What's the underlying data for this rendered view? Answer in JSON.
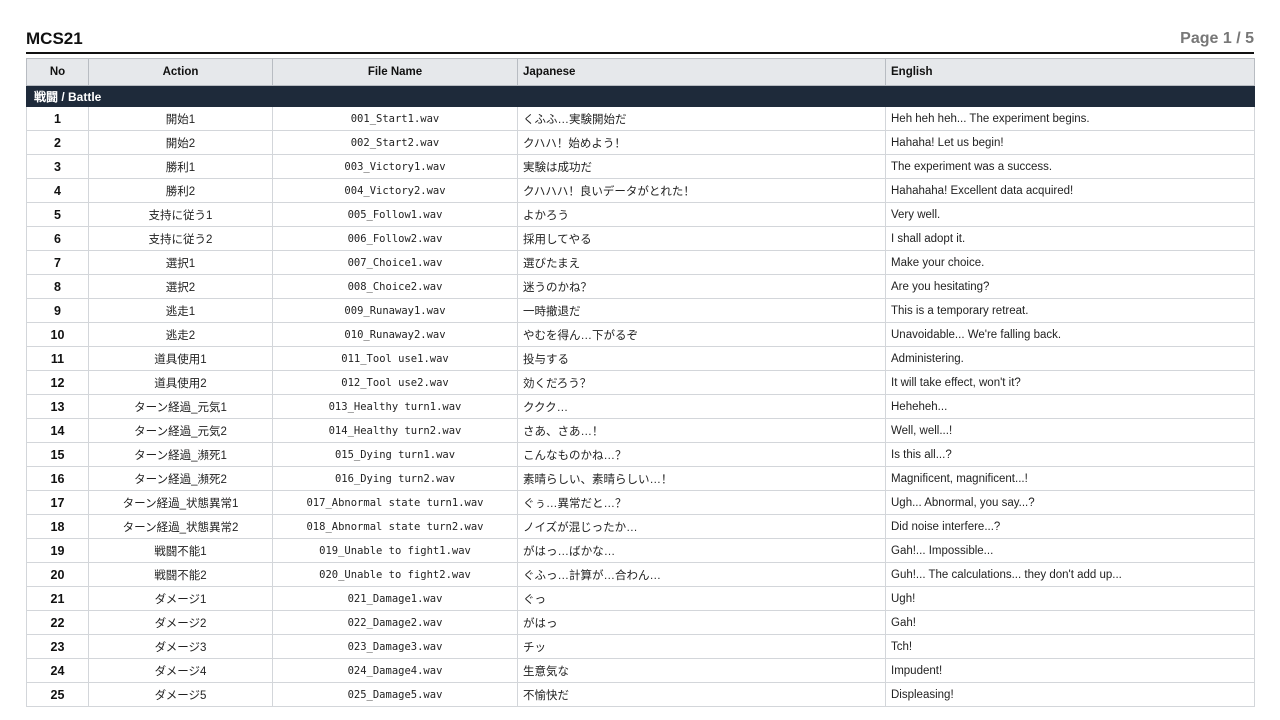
{
  "header": {
    "title": "MCS21",
    "page_indicator": "Page 1 / 5"
  },
  "table": {
    "columns": [
      "No",
      "Action",
      "File Name",
      "Japanese",
      "English"
    ],
    "section": "戦闘 / Battle",
    "rows": [
      {
        "no": "1",
        "action": "開始1",
        "file": "001_Start1.wav",
        "jp": "くふふ…実験開始だ",
        "en": "Heh heh heh... The experiment begins."
      },
      {
        "no": "2",
        "action": "開始2",
        "file": "002_Start2.wav",
        "jp": "クハハ！始めよう！",
        "en": "Hahaha! Let us begin!"
      },
      {
        "no": "3",
        "action": "勝利1",
        "file": "003_Victory1.wav",
        "jp": "実験は成功だ",
        "en": "The experiment was a success."
      },
      {
        "no": "4",
        "action": "勝利2",
        "file": "004_Victory2.wav",
        "jp": "クハハハ！良いデータがとれた！",
        "en": "Hahahaha! Excellent data acquired!"
      },
      {
        "no": "5",
        "action": "支持に従う1",
        "file": "005_Follow1.wav",
        "jp": "よかろう",
        "en": "Very well."
      },
      {
        "no": "6",
        "action": "支持に従う2",
        "file": "006_Follow2.wav",
        "jp": "採用してやる",
        "en": "I shall adopt it."
      },
      {
        "no": "7",
        "action": "選択1",
        "file": "007_Choice1.wav",
        "jp": "選びたまえ",
        "en": "Make your choice."
      },
      {
        "no": "8",
        "action": "選択2",
        "file": "008_Choice2.wav",
        "jp": "迷うのかね？",
        "en": "Are you hesitating?"
      },
      {
        "no": "9",
        "action": "逃走1",
        "file": "009_Runaway1.wav",
        "jp": "一時撤退だ",
        "en": "This is a temporary retreat."
      },
      {
        "no": "10",
        "action": "逃走2",
        "file": "010_Runaway2.wav",
        "jp": "やむを得ん…下がるぞ",
        "en": "Unavoidable... We're falling back."
      },
      {
        "no": "11",
        "action": "道具使用1",
        "file": "011_Tool use1.wav",
        "jp": "投与する",
        "en": "Administering."
      },
      {
        "no": "12",
        "action": "道具使用2",
        "file": "012_Tool use2.wav",
        "jp": "効くだろう？",
        "en": "It will take effect, won't it?"
      },
      {
        "no": "13",
        "action": "ターン経過_元気1",
        "file": "013_Healthy turn1.wav",
        "jp": "ククク…",
        "en": "Heheheh..."
      },
      {
        "no": "14",
        "action": "ターン経過_元気2",
        "file": "014_Healthy turn2.wav",
        "jp": "さあ、さあ…！",
        "en": "Well, well...!"
      },
      {
        "no": "15",
        "action": "ターン経過_瀕死1",
        "file": "015_Dying turn1.wav",
        "jp": "こんなものかね…？",
        "en": "Is this all...?"
      },
      {
        "no": "16",
        "action": "ターン経過_瀕死2",
        "file": "016_Dying turn2.wav",
        "jp": "素晴らしい、素晴らしい…！",
        "en": "Magnificent, magnificent...!"
      },
      {
        "no": "17",
        "action": "ターン経過_状態異常1",
        "file": "017_Abnormal state turn1.wav",
        "jp": "ぐぅ…異常だと…？",
        "en": "Ugh... Abnormal, you say...?"
      },
      {
        "no": "18",
        "action": "ターン経過_状態異常2",
        "file": "018_Abnormal state turn2.wav",
        "jp": "ノイズが混じったか…",
        "en": "Did noise interfere...?"
      },
      {
        "no": "19",
        "action": "戦闘不能1",
        "file": "019_Unable to fight1.wav",
        "jp": "がはっ…ばかな…",
        "en": "Gah!... Impossible..."
      },
      {
        "no": "20",
        "action": "戦闘不能2",
        "file": "020_Unable to fight2.wav",
        "jp": "ぐふっ…計算が…合わん…",
        "en": "Guh!... The calculations... they don't add up..."
      },
      {
        "no": "21",
        "action": "ダメージ1",
        "file": "021_Damage1.wav",
        "jp": "ぐっ",
        "en": "Ugh!"
      },
      {
        "no": "22",
        "action": "ダメージ2",
        "file": "022_Damage2.wav",
        "jp": "がはっ",
        "en": "Gah!"
      },
      {
        "no": "23",
        "action": "ダメージ3",
        "file": "023_Damage3.wav",
        "jp": "チッ",
        "en": "Tch!"
      },
      {
        "no": "24",
        "action": "ダメージ4",
        "file": "024_Damage4.wav",
        "jp": "生意気な",
        "en": "Impudent!"
      },
      {
        "no": "25",
        "action": "ダメージ5",
        "file": "025_Damage5.wav",
        "jp": "不愉快だ",
        "en": "Displeasing!"
      }
    ]
  },
  "colors": {
    "section_band": "#1e2a3a",
    "header_bg": "#e6e8eb",
    "page_indicator": "#777777"
  }
}
